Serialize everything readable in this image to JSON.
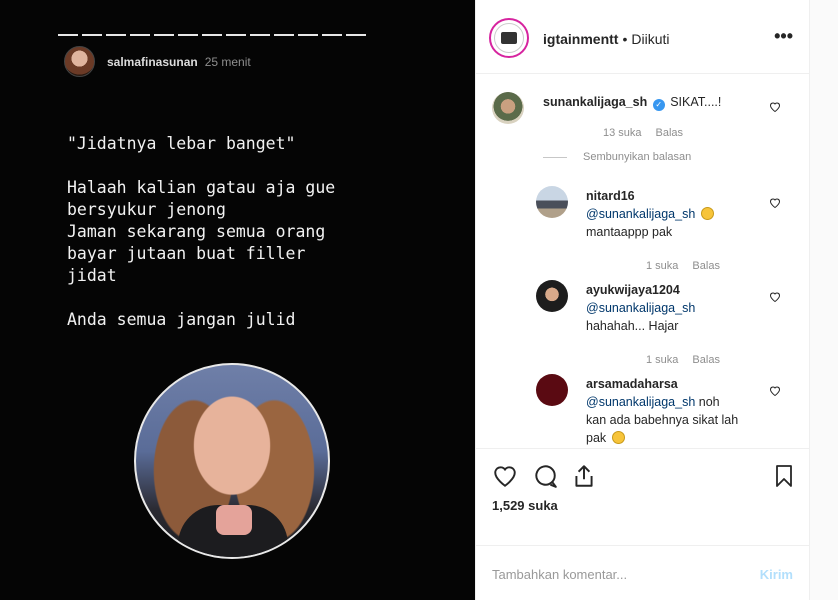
{
  "story": {
    "username": "salmafinasunan",
    "time": "25 menit",
    "text": "\"Jidatnya lebar banget\"\n\nHalaah kalian gatau aja gue\nbersyukur jenong\nJaman sekarang semua orang\nbayar jutaan buat filler\njidat\n\nAnda semua jangan julid",
    "progress_segments": 13
  },
  "header": {
    "username": "igtainmentt",
    "separator": "•",
    "follow_status": "Diikuti",
    "more_icon": "more-horizontal-icon"
  },
  "comments": {
    "main": {
      "username": "sunankalijaga_sh",
      "verified": true,
      "text": "SIKAT....!",
      "likes": "13 suka",
      "reply": "Balas"
    },
    "hide_replies": "Sembunyikan balasan",
    "replies": [
      {
        "username": "nitard16",
        "mention": "@sunankalijaga_sh",
        "text": "",
        "line2": "mantaappp pak",
        "likes": "1 suka",
        "reply": "Balas"
      },
      {
        "username": "ayukwijaya1204",
        "mention": "@sunankalijaga_sh",
        "text": "",
        "line2": "hahahah... Hajar",
        "likes": "1 suka",
        "reply": "Balas"
      },
      {
        "username": "arsamadaharsa",
        "mention": "@sunankalijaga_sh",
        "text": "noh",
        "line2": "kan ada babehnya sikat lah",
        "line3": "pak"
      }
    ]
  },
  "actions": {
    "likes": "1,529 suka"
  },
  "add_comment": {
    "placeholder": "Tambahkan komentar...",
    "post": "Kirim"
  },
  "colors": {
    "link": "#00376b",
    "verified": "#3897f0",
    "post_disabled": "#b2dffc"
  }
}
